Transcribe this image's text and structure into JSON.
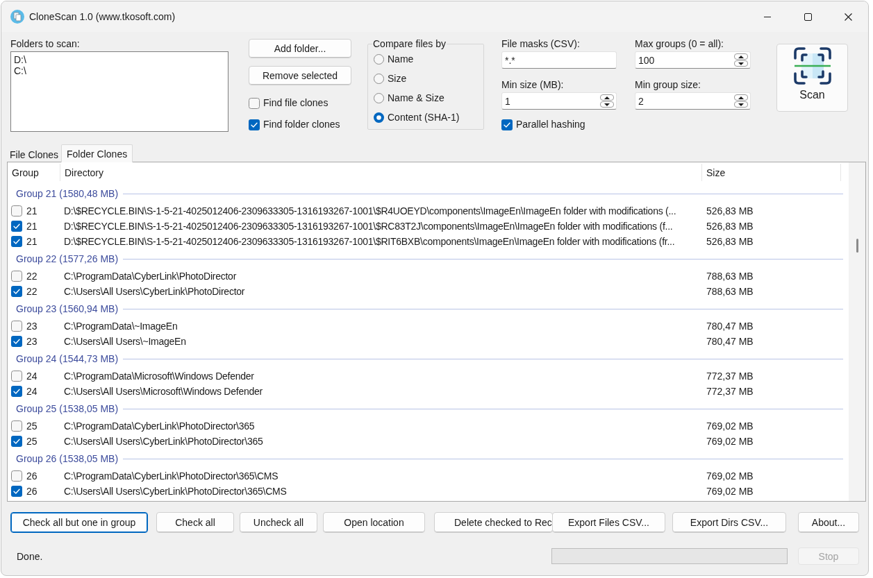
{
  "window": {
    "title": "CloneScan 1.0 (www.tkosoft.com)"
  },
  "folders": {
    "label": "Folders to scan:",
    "items": [
      "D:\\",
      "C:\\"
    ]
  },
  "folder_buttons": [
    "Add folder...",
    "Remove selected"
  ],
  "clone_options": [
    {
      "label": "Find file clones",
      "checked": false
    },
    {
      "label": "Find folder clones",
      "checked": true
    }
  ],
  "compare_by": {
    "title": "Compare files by",
    "choices": [
      {
        "label": "Name",
        "selected": false
      },
      {
        "label": "Size",
        "selected": false
      },
      {
        "label": "Name & Size",
        "selected": false
      },
      {
        "label": "Content (SHA-1)",
        "selected": true
      }
    ]
  },
  "settings": [
    {
      "label": "File masks (CSV):",
      "value": "*.*",
      "kind": "text"
    },
    {
      "label": "Max groups (0 = all):",
      "value": "100",
      "kind": "spin"
    },
    {
      "label": "Min size (MB):",
      "value": "1",
      "kind": "spin"
    },
    {
      "label": "Min group size:",
      "value": "2",
      "kind": "spin"
    }
  ],
  "parallel_hashing": {
    "label": "Parallel hashing",
    "checked": true
  },
  "scan_button": {
    "label": "Scan"
  },
  "tabs": [
    {
      "label": "File Clones",
      "selected": false
    },
    {
      "label": "Folder Clones",
      "selected": true
    }
  ],
  "table": {
    "columns": [
      "Group",
      "Directory",
      "Size"
    ],
    "groups": [
      {
        "title": "Group 21 (1580,48 MB)",
        "rows": [
          {
            "group": "21",
            "directory": "D:\\$RECYCLE.BIN\\S-1-5-21-4025012406-2309633305-1316193267-1001\\$R4UOEYD\\components\\ImageEn\\ImageEn folder with modifications (...",
            "size": "526,83 MB",
            "checked": false
          },
          {
            "group": "21",
            "directory": "D:\\$RECYCLE.BIN\\S-1-5-21-4025012406-2309633305-1316193267-1001\\$RC83T2J\\components\\ImageEn\\ImageEn folder with modifications (f...",
            "size": "526,83 MB",
            "checked": true
          },
          {
            "group": "21",
            "directory": "D:\\$RECYCLE.BIN\\S-1-5-21-4025012406-2309633305-1316193267-1001\\$RIT6BXB\\components\\ImageEn\\ImageEn folder with modifications (fr...",
            "size": "526,83 MB",
            "checked": true
          }
        ]
      },
      {
        "title": "Group 22 (1577,26 MB)",
        "rows": [
          {
            "group": "22",
            "directory": "C:\\ProgramData\\CyberLink\\PhotoDirector",
            "size": "788,63 MB",
            "checked": false
          },
          {
            "group": "22",
            "directory": "C:\\Users\\All Users\\CyberLink\\PhotoDirector",
            "size": "788,63 MB",
            "checked": true
          }
        ]
      },
      {
        "title": "Group 23 (1560,94 MB)",
        "rows": [
          {
            "group": "23",
            "directory": "C:\\ProgramData\\~ImageEn",
            "size": "780,47 MB",
            "checked": false
          },
          {
            "group": "23",
            "directory": "C:\\Users\\All Users\\~ImageEn",
            "size": "780,47 MB",
            "checked": true
          }
        ]
      },
      {
        "title": "Group 24 (1544,73 MB)",
        "rows": [
          {
            "group": "24",
            "directory": "C:\\ProgramData\\Microsoft\\Windows Defender",
            "size": "772,37 MB",
            "checked": false
          },
          {
            "group": "24",
            "directory": "C:\\Users\\All Users\\Microsoft\\Windows Defender",
            "size": "772,37 MB",
            "checked": true
          }
        ]
      },
      {
        "title": "Group 25 (1538,05 MB)",
        "rows": [
          {
            "group": "25",
            "directory": "C:\\ProgramData\\CyberLink\\PhotoDirector\\365",
            "size": "769,02 MB",
            "checked": false
          },
          {
            "group": "25",
            "directory": "C:\\Users\\All Users\\CyberLink\\PhotoDirector\\365",
            "size": "769,02 MB",
            "checked": true
          }
        ]
      },
      {
        "title": "Group 26 (1538,05 MB)",
        "rows": [
          {
            "group": "26",
            "directory": "C:\\ProgramData\\CyberLink\\PhotoDirector\\365\\CMS",
            "size": "769,02 MB",
            "checked": false
          },
          {
            "group": "26",
            "directory": "C:\\Users\\All Users\\CyberLink\\PhotoDirector\\365\\CMS",
            "size": "769,02 MB",
            "checked": true
          }
        ]
      }
    ]
  },
  "actions": [
    {
      "label": "Check all but one in group",
      "focused": true
    },
    {
      "label": "Check all",
      "focused": false
    },
    {
      "label": "Uncheck all",
      "focused": false
    },
    {
      "label": "Open location",
      "focused": false
    },
    {
      "label": "Delete checked to Rec",
      "focused": false
    },
    {
      "label": "Export Files CSV...",
      "focused": false
    },
    {
      "label": "Export Dirs CSV...",
      "focused": false
    },
    {
      "label": "About...",
      "focused": false
    }
  ],
  "status_bar": {
    "text": "Done.",
    "progress": {
      "level": 0
    },
    "stop_button": {
      "label": "Stop",
      "disabled": true
    }
  }
}
